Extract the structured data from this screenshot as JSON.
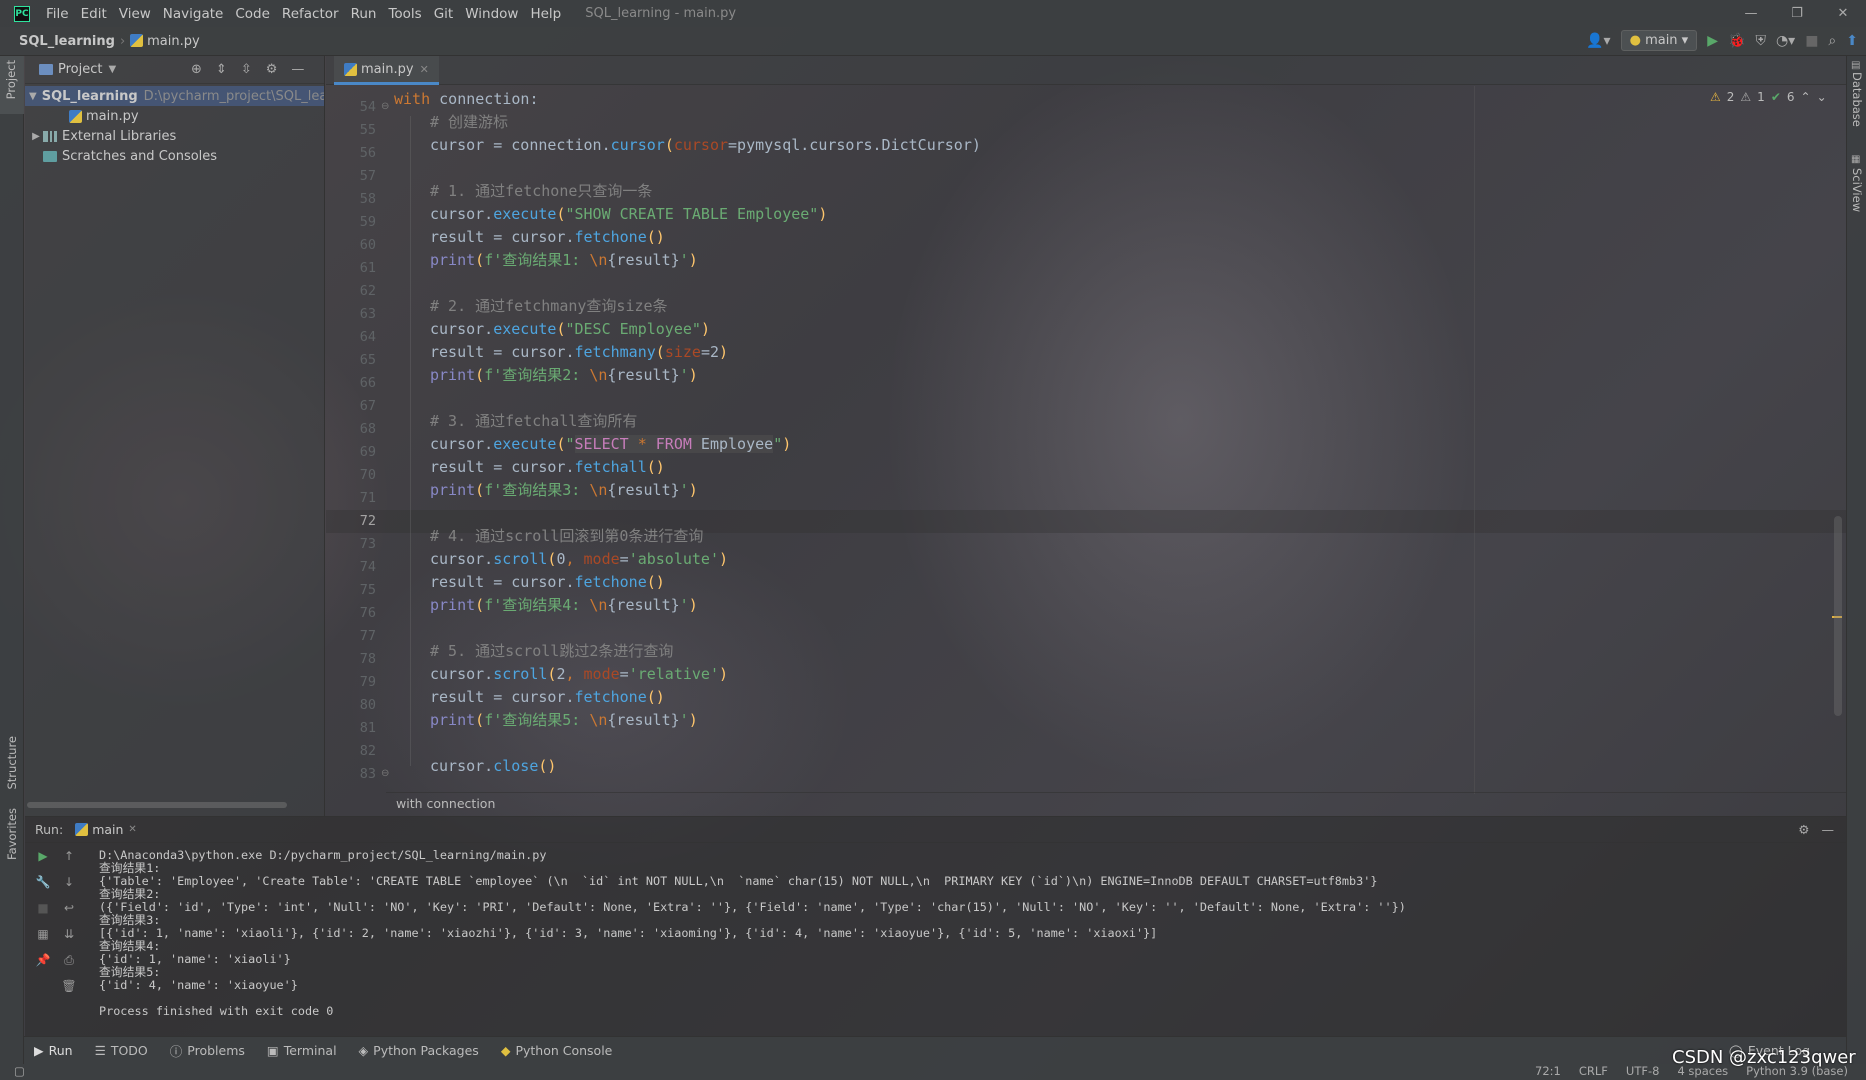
{
  "app": {
    "logo": "PC",
    "window_title": "SQL_learning - main.py",
    "menu": [
      "File",
      "Edit",
      "View",
      "Navigate",
      "Code",
      "Refactor",
      "Run",
      "Tools",
      "Git",
      "Window",
      "Help"
    ]
  },
  "navbar": {
    "project": "SQL_learning",
    "file": "main.py",
    "run_config": "main"
  },
  "left_strip": {
    "project_label": "Project",
    "structure_label": "Structure",
    "favorites_label": "Favorites"
  },
  "right_strip": {
    "database_label": "Database",
    "sciview_label": "SciView"
  },
  "project_panel": {
    "title": "Project",
    "root": "SQL_learning",
    "root_path": "D:\\pycharm_project\\SQL_lea",
    "file": "main.py",
    "libs": "External Libraries",
    "scratches": "Scratches and Consoles"
  },
  "editor": {
    "tab": "main.py",
    "breadcrumb": "with connection",
    "inspections": {
      "warn_a": "2",
      "warn_b": "1",
      "ok": "6"
    },
    "line_numbers": [
      "54",
      "55",
      "56",
      "57",
      "58",
      "59",
      "60",
      "61",
      "62",
      "63",
      "64",
      "65",
      "66",
      "67",
      "68",
      "69",
      "70",
      "71",
      "72",
      "73",
      "74",
      "75",
      "76",
      "77",
      "78",
      "79",
      "80",
      "81",
      "82",
      "83"
    ],
    "current_line": "72",
    "lines": {
      "l0": {
        "a": "with",
        " b": "",
        "t": " connection:"
      },
      "l1": "# 创建游标",
      "l2": {
        "a": "cursor = connection.",
        "b": "cursor",
        "c": "(",
        "d": "cursor",
        "e": "=pymysql.cursors.DictCursor)"
      },
      "l4": "# 1. 通过fetchone只查询一条",
      "l5": {
        "a": "cursor.",
        "b": "execute",
        "c": "(",
        "d": "\"SHOW CREATE TABLE Employee\"",
        "e": ")"
      },
      "l6": {
        "a": "result = cursor.",
        "b": "fetchone",
        "c": "()"
      },
      "l7": {
        "a": "print",
        "b": "(",
        "c": "f'查询结果1: ",
        "d": "\\n",
        "e": "{result}",
        "f": "'",
        "g": ")"
      },
      "l9": "# 2. 通过fetchmany查询size条",
      "l10": {
        "a": "cursor.",
        "b": "execute",
        "c": "(",
        "d": "\"DESC Employee\"",
        "e": ")"
      },
      "l11": {
        "a": "result = cursor.",
        "b": "fetchmany",
        "c": "(",
        "d": "size",
        "e": "=",
        "f": "2",
        "g": ")"
      },
      "l12": {
        "a": "print",
        "b": "(",
        "c": "f'查询结果2: ",
        "d": "\\n",
        "e": "{result}",
        "f": "'",
        "g": ")"
      },
      "l14": "# 3. 通过fetchall查询所有",
      "l15": {
        "a": "cursor.",
        "b": "execute",
        "c": "(",
        "d": "\"",
        "e": "SELECT",
        "f": " * ",
        "g": "FROM",
        "h": " Employee",
        "i": "\"",
        "j": ")"
      },
      "l16": {
        "a": "result = cursor.",
        "b": "fetchall",
        "c": "()"
      },
      "l17": {
        "a": "print",
        "b": "(",
        "c": "f'查询结果3: ",
        "d": "\\n",
        "e": "{result}",
        "f": "'",
        "g": ")"
      },
      "l19": "# 4. 通过scroll回滚到第0条进行查询",
      "l20": {
        "a": "cursor.",
        "b": "scroll",
        "c": "(",
        "d": "0",
        "e": ", ",
        "f": "mode",
        "g": "=",
        "h": "'absolute'",
        "i": ")"
      },
      "l21": {
        "a": "result = cursor.",
        "b": "fetchone",
        "c": "()"
      },
      "l22": {
        "a": "print",
        "b": "(",
        "c": "f'查询结果4: ",
        "d": "\\n",
        "e": "{result}",
        "f": "'",
        "g": ")"
      },
      "l24": "# 5. 通过scroll跳过2条进行查询",
      "l25": {
        "a": "cursor.",
        "b": "scroll",
        "c": "(",
        "d": "2",
        "e": ", ",
        "f": "mode",
        "g": "=",
        "h": "'relative'",
        "i": ")"
      },
      "l26": {
        "a": "result = cursor.",
        "b": "fetchone",
        "c": "()"
      },
      "l27": {
        "a": "print",
        "b": "(",
        "c": "f'查询结果5: ",
        "d": "\\n",
        "e": "{result}",
        "f": "'",
        "g": ")"
      },
      "l29": {
        "a": "cursor.",
        "b": "close",
        "c": "()"
      }
    }
  },
  "run_panel": {
    "label": "Run:",
    "tab": "main",
    "output": [
      "D:\\Anaconda3\\python.exe D:/pycharm_project/SQL_learning/main.py",
      "查询结果1:",
      "{'Table': 'Employee', 'Create Table': 'CREATE TABLE `employee` (\\n  `id` int NOT NULL,\\n  `name` char(15) NOT NULL,\\n  PRIMARY KEY (`id`)\\n) ENGINE=InnoDB DEFAULT CHARSET=utf8mb3'}",
      "查询结果2:",
      "({'Field': 'id', 'Type': 'int', 'Null': 'NO', 'Key': 'PRI', 'Default': None, 'Extra': ''}, {'Field': 'name', 'Type': 'char(15)', 'Null': 'NO', 'Key': '', 'Default': None, 'Extra': ''})",
      "查询结果3:",
      "[{'id': 1, 'name': 'xiaoli'}, {'id': 2, 'name': 'xiaozhi'}, {'id': 3, 'name': 'xiaoming'}, {'id': 4, 'name': 'xiaoyue'}, {'id': 5, 'name': 'xiaoxi'}]",
      "查询结果4:",
      "{'id': 1, 'name': 'xiaoli'}",
      "查询结果5:",
      "{'id': 4, 'name': 'xiaoyue'}",
      "",
      "Process finished with exit code 0"
    ]
  },
  "toolwindows": [
    "Run",
    "TODO",
    "Problems",
    "Terminal",
    "Python Packages",
    "Python Console"
  ],
  "event_log": "Event Log",
  "status_bar": {
    "position": "72:1",
    "line_sep": "CRLF",
    "encoding": "UTF-8",
    "indent": "4 spaces",
    "interpreter": "Python 3.9 (base)"
  },
  "watermark": "CSDN @zxc123qwer",
  "colors": {
    "accent": "#4a88c7",
    "keyword": "#cc7832",
    "string": "#6aab73",
    "comment": "#808080",
    "method": "#4ea5e0"
  }
}
